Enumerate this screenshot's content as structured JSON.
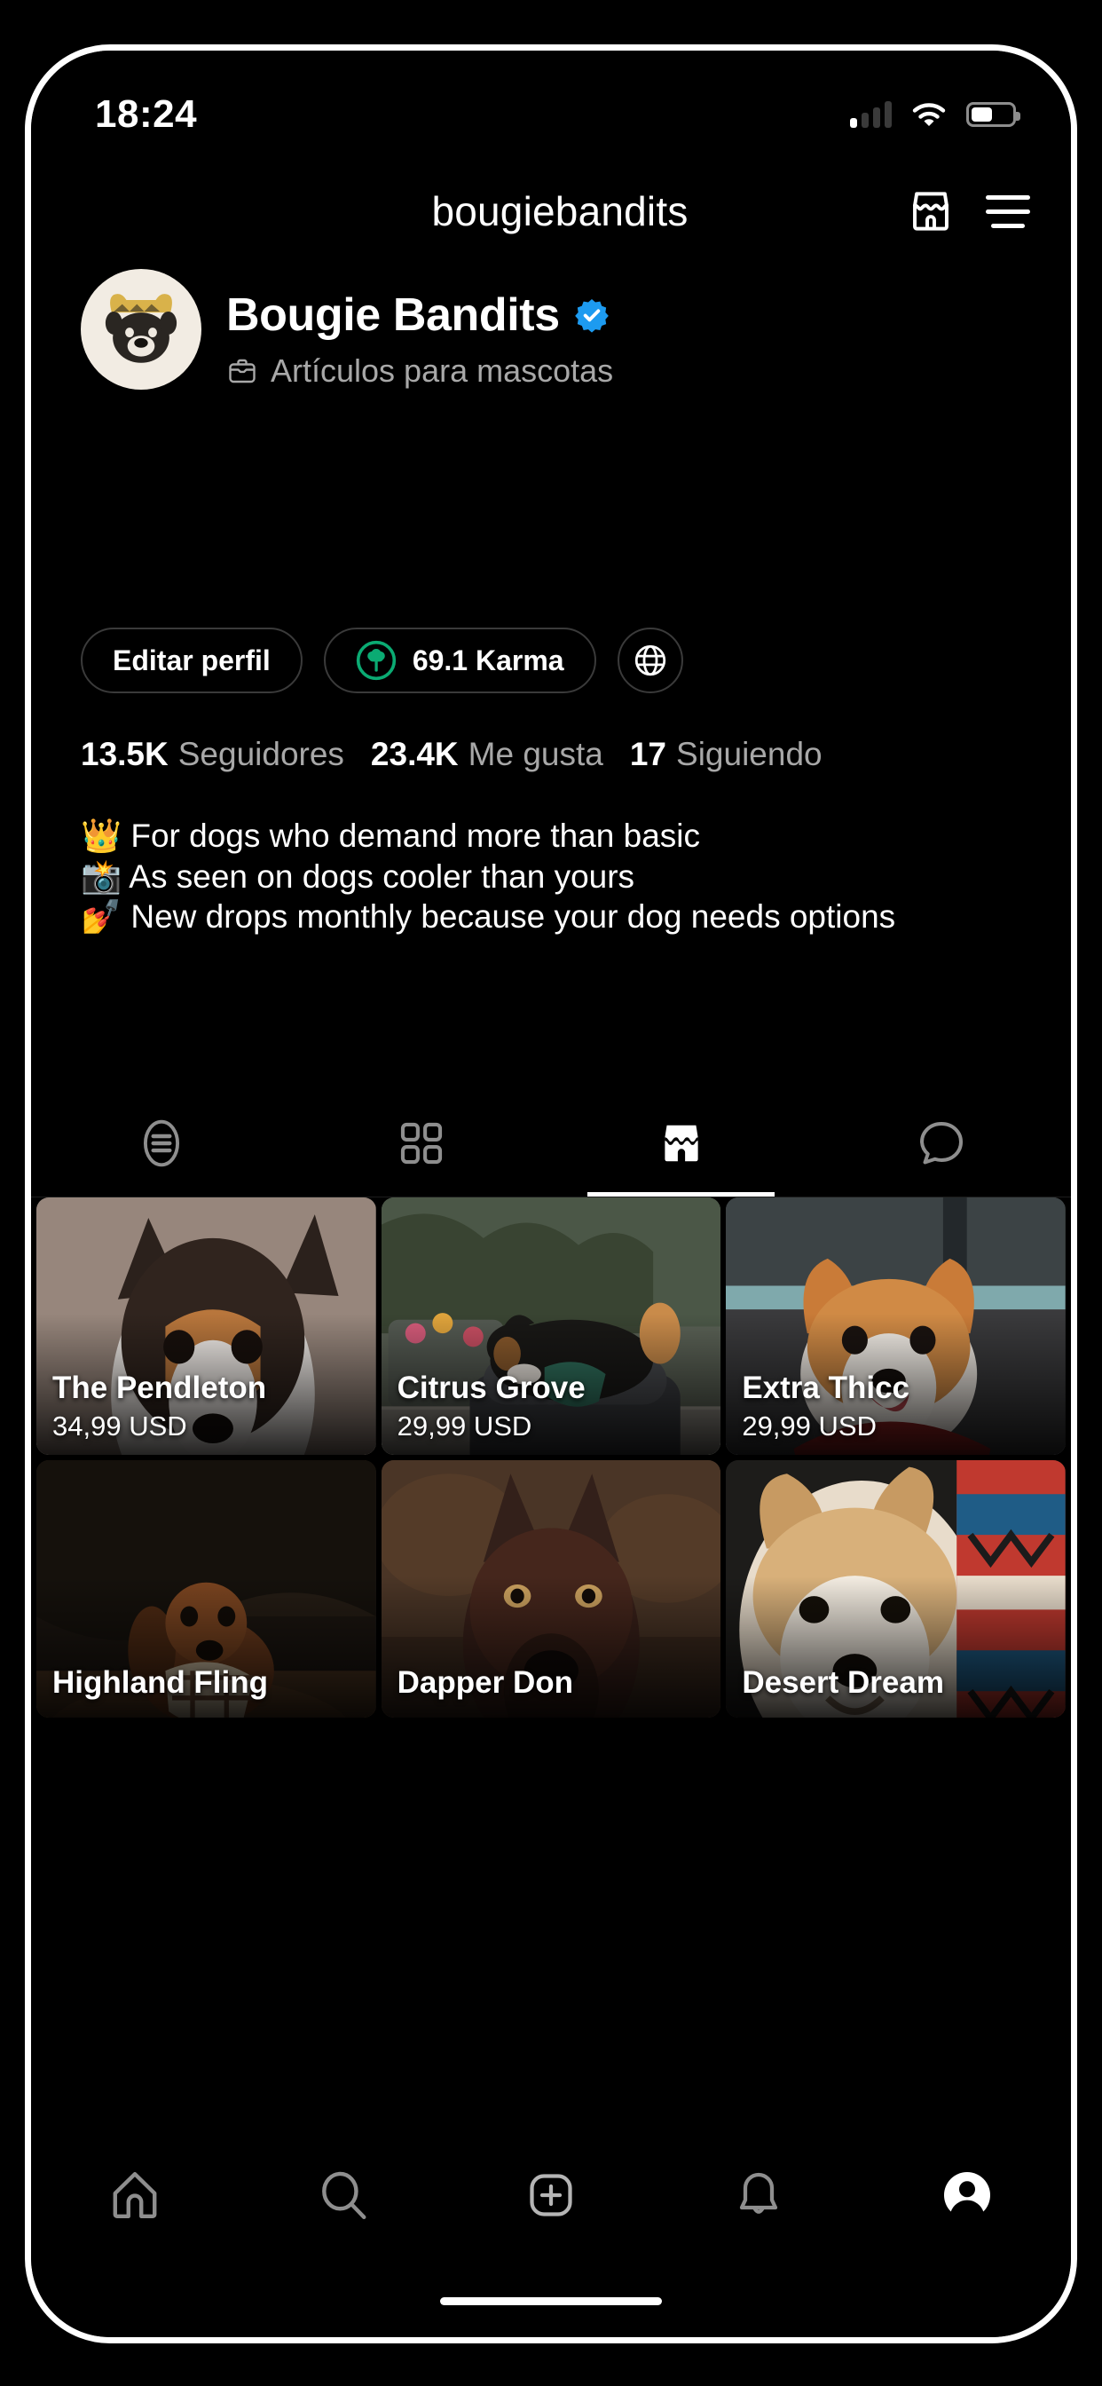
{
  "status_bar": {
    "time": "18:24",
    "signal_icon": "cellular-signal-icon",
    "signal_bars_total": 4,
    "signal_bars_active": 1,
    "wifi_icon": "wifi-icon",
    "battery_icon": "battery-icon",
    "battery_level_percent": 50
  },
  "header": {
    "title": "bougiebandits",
    "shop_icon": "storefront-icon",
    "menu_icon": "hamburger-menu-icon"
  },
  "profile": {
    "avatar_icon": "profile-avatar-bulldog",
    "display_name": "Bougie Bandits",
    "verified_icon": "verified-badge-icon",
    "category_icon": "briefcase-icon",
    "category": "Artículos para mascotas",
    "buttons": {
      "edit_profile": "Editar perfil",
      "karma_icon": "tree-karma-icon",
      "karma": "69.1 Karma",
      "globe_icon": "globe-icon"
    },
    "stats": [
      {
        "value": "13.5K",
        "label": "Seguidores"
      },
      {
        "value": "23.4K",
        "label": "Me gusta"
      },
      {
        "value": "17",
        "label": "Siguiendo"
      }
    ],
    "bio": [
      "👑 For dogs who demand more than basic",
      "📸 As seen on dogs cooler than yours",
      "💅 New drops monthly because your dog needs options"
    ]
  },
  "profile_tabs": [
    {
      "name": "tab-feed",
      "icon": "list-feed-icon",
      "active": false
    },
    {
      "name": "tab-grid",
      "icon": "grid-icon",
      "active": false
    },
    {
      "name": "tab-shop",
      "icon": "storefront-icon",
      "active": true
    },
    {
      "name": "tab-tagged",
      "icon": "chat-bubble-icon",
      "active": false
    }
  ],
  "products": [
    {
      "name": "The Pendleton",
      "price": "34,99 USD",
      "image": "dog-with-patterned-bandana"
    },
    {
      "name": "Citrus Grove",
      "price": "29,99 USD",
      "image": "bernese-dog-on-bed"
    },
    {
      "name": "Extra Thicc",
      "price": "29,99 USD",
      "image": "corgi-with-bandana"
    },
    {
      "name": "Highland Fling",
      "price": "",
      "image": "dachshund-in-forest"
    },
    {
      "name": "Dapper Don",
      "price": "",
      "image": "doberman-portrait"
    },
    {
      "name": "Desert Dream",
      "price": "",
      "image": "shiba-with-blanket"
    }
  ],
  "bottom_nav": [
    {
      "name": "nav-home",
      "icon": "home-icon",
      "active": false
    },
    {
      "name": "nav-search",
      "icon": "search-icon",
      "active": false
    },
    {
      "name": "nav-create",
      "icon": "plus-square-icon",
      "active": false
    },
    {
      "name": "nav-activity",
      "icon": "bell-icon",
      "active": false
    },
    {
      "name": "nav-profile",
      "icon": "person-avatar-icon",
      "active": true
    }
  ],
  "colors": {
    "background": "#000000",
    "verified_blue": "#1d9bf0",
    "karma_green": "#0bab73",
    "muted_text": "#a8a8a8",
    "border": "#3a3a3a"
  }
}
